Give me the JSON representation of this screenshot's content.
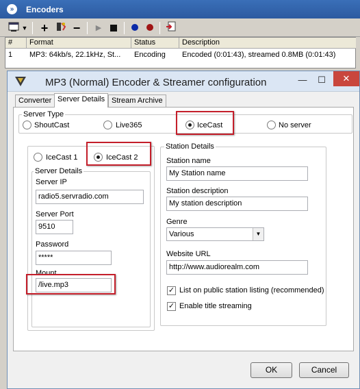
{
  "encoders_window": {
    "title": "Encoders",
    "columns": [
      "#",
      "Format",
      "Status",
      "Description"
    ],
    "rows": [
      {
        "num": "1",
        "format": "MP3: 64kb/s, 22.1kHz, St...",
        "status": "Encoding",
        "description": "Encoded (0:01:43), streamed 0.8MB (0:01:43)"
      }
    ]
  },
  "dialog": {
    "title": "MP3 (Normal) Encoder & Streamer configuration",
    "tabs": [
      "Converter",
      "Server Details",
      "Stream Archive"
    ],
    "active_tab": "Server Details",
    "server_type": {
      "label": "Server Type",
      "options": [
        "ShoutCast",
        "Live365",
        "IceCast",
        "No server"
      ],
      "selected": "IceCast"
    },
    "icecast_version": {
      "options": [
        "IceCast 1",
        "IceCast 2"
      ],
      "selected": "IceCast 2"
    },
    "server_details": {
      "label": "Server Details",
      "server_ip_label": "Server IP",
      "server_ip": "radio5.servradio.com",
      "server_port_label": "Server Port",
      "server_port": "9510",
      "password_label": "Password",
      "password": "*****",
      "mount_label": "Mount",
      "mount": "/live.mp3"
    },
    "station_details": {
      "label": "Station Details",
      "name_label": "Station name",
      "name": "My Station name",
      "description_label": "Station description",
      "description": "My station description",
      "genre_label": "Genre",
      "genre": "Various",
      "website_label": "Website URL",
      "website": "http://www.audiorealm.com",
      "list_public_label": "List on public station listing (recommended)",
      "list_public_checked": true,
      "title_streaming_label": "Enable title streaming",
      "title_streaming_checked": true
    },
    "ok_label": "OK",
    "cancel_label": "Cancel"
  }
}
